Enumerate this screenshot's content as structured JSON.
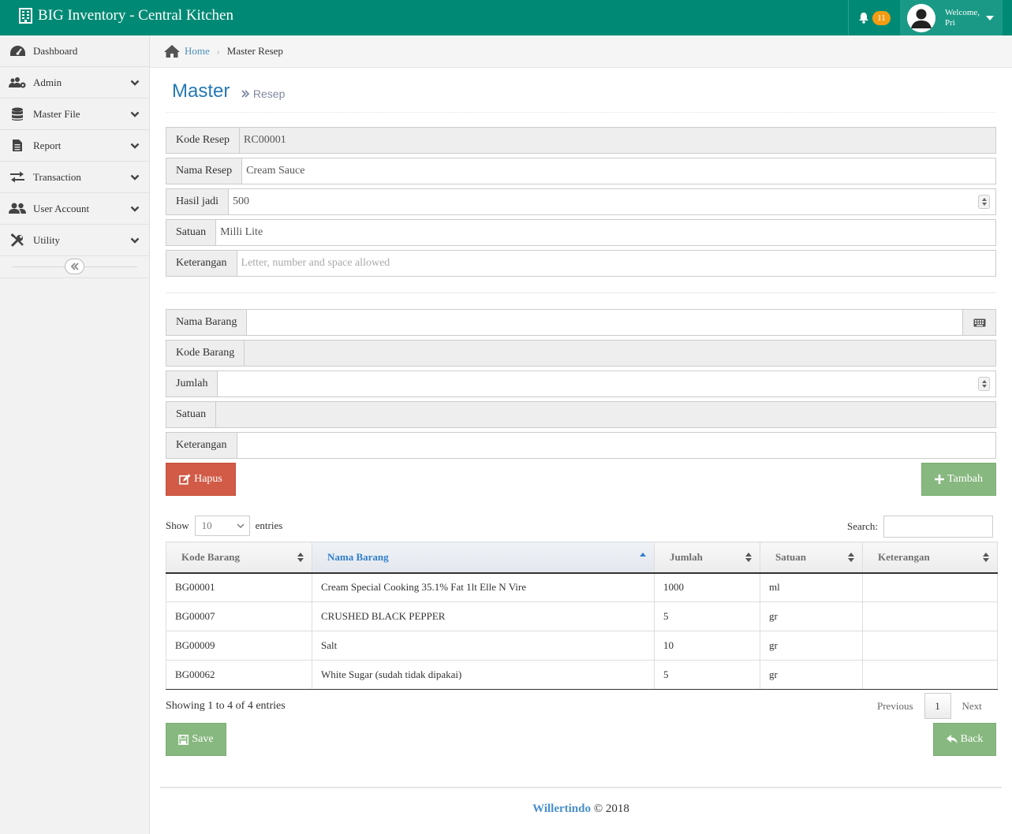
{
  "navbar": {
    "brand": "BIG Inventory - Central Kitchen",
    "notification_count": "11",
    "welcome_label": "Welcome,",
    "user_name": "Pri"
  },
  "sidebar": {
    "items": [
      {
        "label": "Dashboard",
        "icon": "tachometer-icon"
      },
      {
        "label": "Admin",
        "icon": "users-cog-icon"
      },
      {
        "label": "Master File",
        "icon": "database-icon"
      },
      {
        "label": "Report",
        "icon": "file-text-icon"
      },
      {
        "label": "Transaction",
        "icon": "exchange-icon"
      },
      {
        "label": "User Account",
        "icon": "users-icon"
      },
      {
        "label": "Utility",
        "icon": "tools-icon"
      }
    ]
  },
  "breadcrumb": {
    "home": "Home",
    "current": "Master Resep"
  },
  "page": {
    "title": "Master",
    "subtitle": "Resep"
  },
  "recipe_form": {
    "kode_resep_label": "Kode Resep",
    "kode_resep_value": "RC00001",
    "nama_resep_label": "Nama Resep",
    "nama_resep_value": "Cream Sauce",
    "hasil_jadi_label": "Hasil jadi",
    "hasil_jadi_value": "500",
    "satuan_label": "Satuan",
    "satuan_value": "Milli Lite",
    "keterangan_label": "Keterangan",
    "keterangan_placeholder": "Letter, number and space allowed"
  },
  "item_form": {
    "nama_barang_label": "Nama Barang",
    "kode_barang_label": "Kode Barang",
    "jumlah_label": "Jumlah",
    "satuan_label": "Satuan",
    "keterangan_label": "Keterangan"
  },
  "buttons": {
    "hapus": "Hapus",
    "tambah": "Tambah",
    "save": "Save",
    "back": "Back"
  },
  "table": {
    "show_label": "Show",
    "page_length": "10",
    "entries_label": "entries",
    "search_label": "Search:",
    "columns": [
      "Kode Barang",
      "Nama Barang",
      "Jumlah",
      "Satuan",
      "Keterangan"
    ],
    "rows": [
      [
        "BG00001",
        "Cream Special Cooking 35.1% Fat 1lt Elle N Vire",
        "1000",
        "ml",
        ""
      ],
      [
        "BG00007",
        "CRUSHED BLACK PEPPER",
        "5",
        "gr",
        ""
      ],
      [
        "BG00009",
        "Salt",
        "10",
        "gr",
        ""
      ],
      [
        "BG00062",
        "White Sugar (sudah tidak dipakai)",
        "5",
        "gr",
        ""
      ]
    ],
    "info": "Showing 1 to 4 of 4 entries",
    "prev": "Previous",
    "current_page": "1",
    "next": "Next"
  },
  "footer": {
    "brand": "Willertindo",
    "copyright": "© 2018"
  }
}
